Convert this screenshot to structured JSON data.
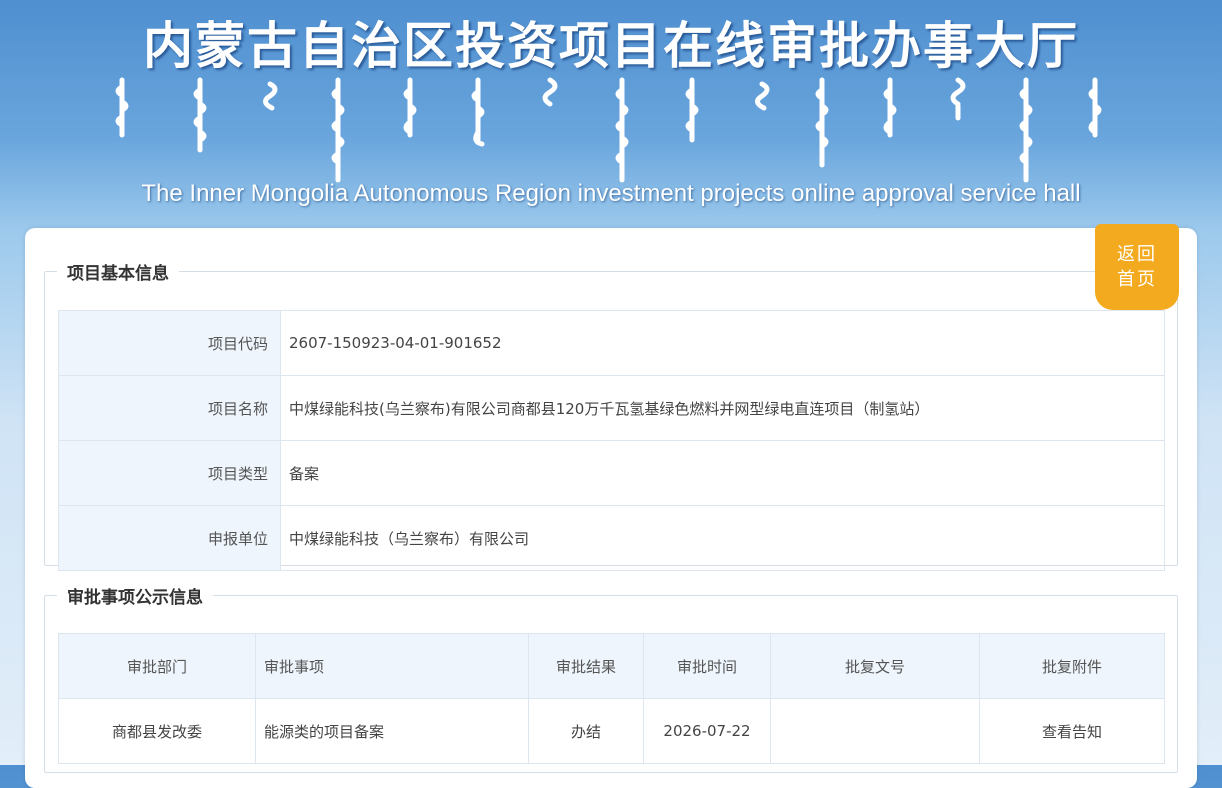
{
  "header": {
    "title_cn": "内蒙古自治区投资项目在线审批办事大厅",
    "title_en": "The Inner Mongolia Autonomous Region investment projects online approval service hall"
  },
  "back_button": {
    "line1": "返回",
    "line2": "首页"
  },
  "project_info": {
    "legend": "项目基本信息",
    "rows": [
      {
        "label": "项目代码",
        "value": "2607-150923-04-01-901652"
      },
      {
        "label": "项目名称",
        "value": "中煤绿能科技(乌兰察布)有限公司商都县120万千瓦氢基绿色燃料并网型绿电直连项目（制氢站）"
      },
      {
        "label": "项目类型",
        "value": "备案"
      },
      {
        "label": "申报单位",
        "value": "中煤绿能科技（乌兰察布）有限公司"
      }
    ]
  },
  "approval_info": {
    "legend": "审批事项公示信息",
    "headers": [
      "审批部门",
      "审批事项",
      "审批结果",
      "审批时间",
      "批复文号",
      "批复附件"
    ],
    "rows": [
      {
        "dept": "商都县发改委",
        "item": "能源类的项目备案",
        "result": "办结",
        "time": "2026-07-22",
        "doc_no": "",
        "attachment": "查看告知"
      }
    ]
  },
  "colors": {
    "accent": "#f3aa1e",
    "header_blue": "#4f8fd0",
    "label_bg": "#eef5fc"
  }
}
